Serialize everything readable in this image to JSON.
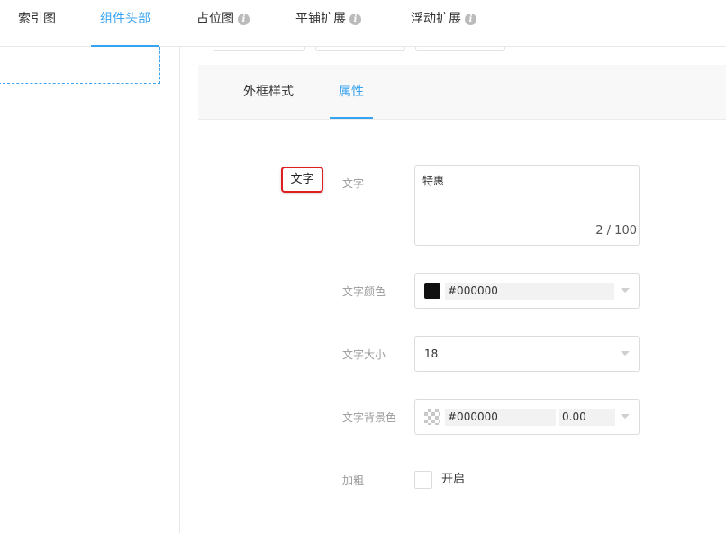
{
  "top_tabs": [
    {
      "label": "索引图",
      "info": false
    },
    {
      "label": "组件头部",
      "info": false,
      "active": true
    },
    {
      "label": "占位图",
      "info": true
    },
    {
      "label": "平铺扩展",
      "info": true
    },
    {
      "label": "浮动扩展",
      "info": true
    }
  ],
  "info_glyph": "i",
  "sub_tabs": [
    {
      "label": "外框样式"
    },
    {
      "label": "属性",
      "active": true
    }
  ],
  "preview_tag": "文字",
  "form": {
    "text_label": "文字",
    "text_value": "特惠",
    "text_count": "2 / 100",
    "color_label": "文字颜色",
    "color_value": "#000000",
    "color_swatch": "#111111",
    "size_label": "文字大小",
    "size_value": "18",
    "bg_label": "文字背景色",
    "bg_value": "#000000",
    "bg_alpha": "0.00",
    "bold_label": "加粗",
    "bold_option": "开启",
    "bold_checked": false
  },
  "colors": {
    "accent": "#38a3f0",
    "highlight_border": "#e02020",
    "label_gray": "#999999"
  }
}
